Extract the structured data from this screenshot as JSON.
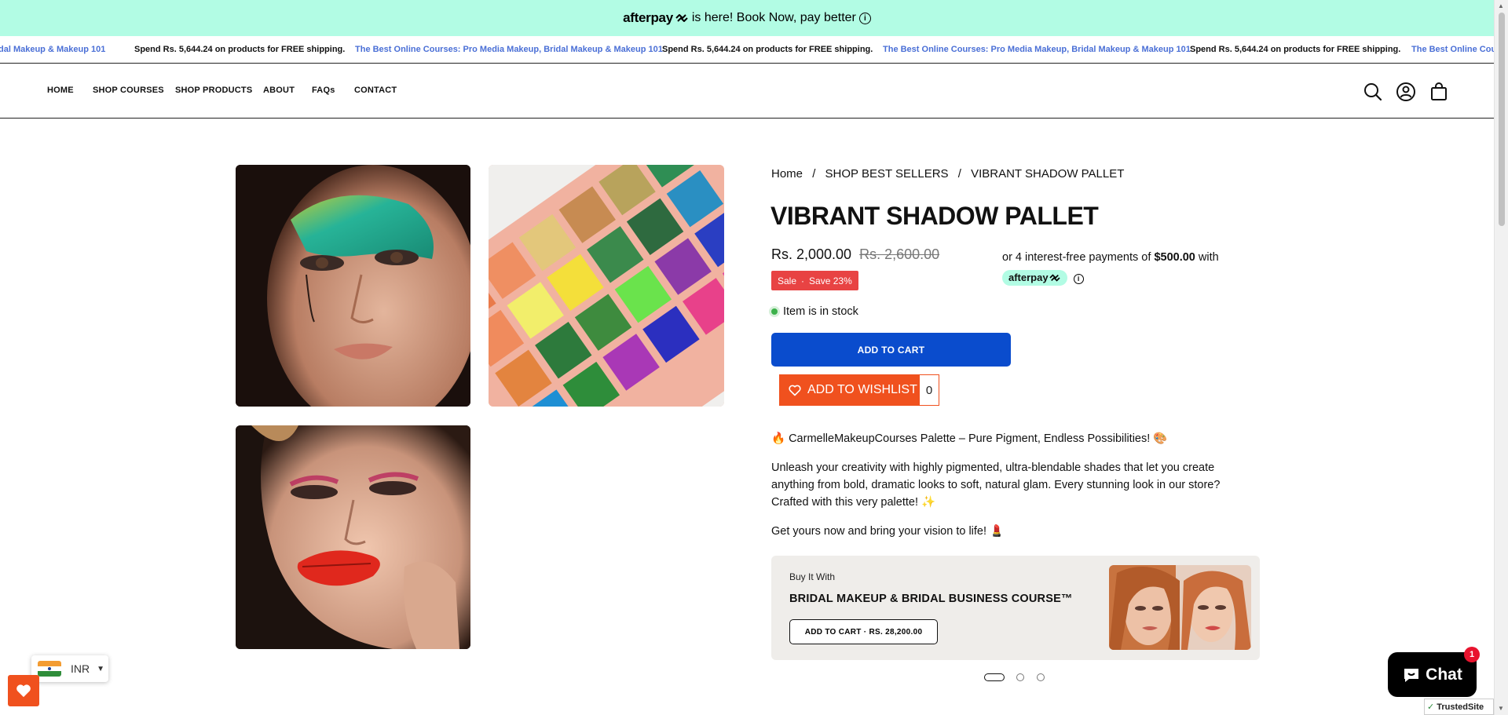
{
  "announcement": {
    "brand": "afterpay",
    "text": "is here! Book Now, pay better",
    "info_icon": "info-icon"
  },
  "ticker": {
    "items": [
      {
        "text": "dal Makeup & Makeup 101",
        "style": "blue"
      },
      {
        "text": "Spend Rs. 5,644.24 on products for FREE shipping.",
        "style": "dark"
      },
      {
        "text": "The Best Online Courses: Pro Media Makeup, Bridal Makeup & Makeup 101",
        "style": "blue"
      },
      {
        "text": "Spend Rs. 5,644.24 on products for FREE shipping.",
        "style": "dark"
      },
      {
        "text": "The Best Online Courses: Pro Media Makeup, Bridal Makeup & Makeup 101",
        "style": "blue"
      },
      {
        "text": "Spend Rs. 5,644.24 on products for FREE shipping.",
        "style": "dark"
      },
      {
        "text": "The Best Online Course",
        "style": "blue"
      }
    ]
  },
  "nav": {
    "links": [
      "HOME",
      "SHOP COURSES",
      "SHOP PRODUCTS",
      "ABOUT",
      "FAQs",
      "CONTACT"
    ],
    "icons": [
      "search-icon",
      "account-icon",
      "cart-bag-icon"
    ]
  },
  "breadcrumb": {
    "home": "Home",
    "sep": "/",
    "category": "SHOP BEST SELLERS",
    "current": "VIBRANT SHADOW PALLET"
  },
  "product": {
    "title": "VIBRANT SHADOW PALLET",
    "price": "Rs. 2,000.00",
    "compare_price": "Rs. 2,600.00",
    "sale_label": "Sale",
    "save_label": "Save 23%",
    "afterpay_prefix": "or 4 interest-free payments of",
    "afterpay_amount": "$500.00",
    "afterpay_suffix": "with",
    "afterpay_brand": "afterpay",
    "stock_text": "Item is in stock",
    "add_to_cart": "ADD TO CART",
    "wishlist_label": "ADD TO WISHLIST",
    "wishlist_count": "0",
    "desc_headline": "🔥 CarmelleMakeupCourses Palette – Pure Pigment, Endless Possibilities! 🎨",
    "desc_body": "Unleash your creativity with highly pigmented, ultra-blendable shades that let you create anything from bold, dramatic looks to soft, natural glam. Every stunning look in our store? Crafted with this very palette! ✨",
    "desc_cta": "Get yours now and bring your vision to life! 💄"
  },
  "bundle": {
    "label": "Buy It With",
    "title": "BRIDAL MAKEUP & BRIDAL BUSINESS COURSE™",
    "button": "ADD TO CART · RS. 28,200.00"
  },
  "pager": {
    "count": 3,
    "active": 0
  },
  "currency": {
    "code": "INR"
  },
  "chat": {
    "label": "Chat",
    "badge": "1"
  },
  "trusted": {
    "label": "TrustedSite"
  },
  "colors": {
    "afterpay_mint": "#b2fce4",
    "primary_blue": "#0a4ccd",
    "sale_red": "#e84343",
    "wishlist_orange": "#f0511e",
    "ticker_blue": "#4a6fd6"
  }
}
